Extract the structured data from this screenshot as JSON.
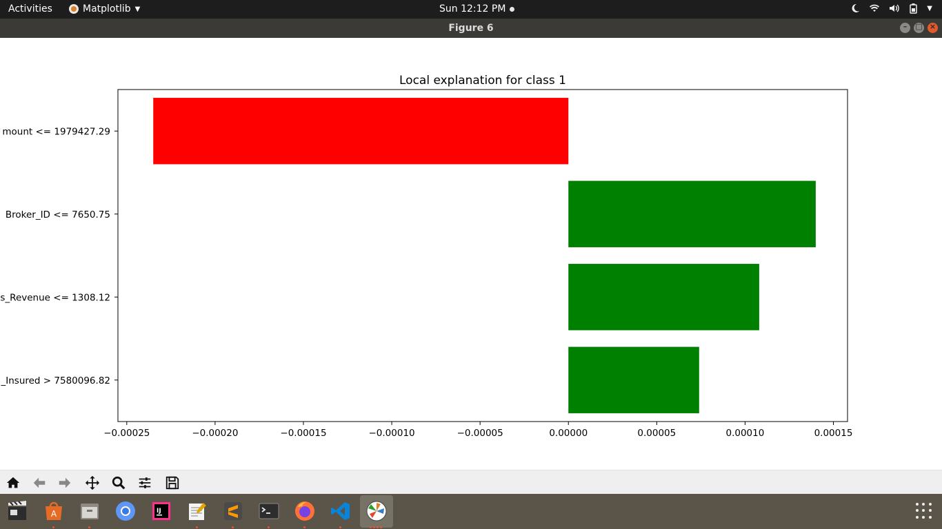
{
  "topbar": {
    "activities": "Activities",
    "app_menu": "Matplotlib",
    "clock": "Sun 12:12 PM"
  },
  "window": {
    "title": "Figure 6"
  },
  "icons": {
    "tray": [
      "night-mode-icon",
      "wifi-icon",
      "volume-icon",
      "battery-icon"
    ],
    "toolbar": [
      "home-icon",
      "back-icon",
      "forward-icon",
      "pan-icon",
      "zoom-icon",
      "configure-subplots-icon",
      "save-icon"
    ],
    "dock": [
      "video-player-icon",
      "software-center-icon",
      "file-manager-icon",
      "chromium-icon",
      "intellij-icon",
      "text-editor-icon",
      "sublime-text-icon",
      "terminal-icon",
      "firefox-icon",
      "vscode-icon",
      "matplotlib-icon"
    ]
  },
  "chart_data": {
    "type": "bar",
    "orientation": "horizontal",
    "title": "Local explanation for class 1",
    "categories": [
      "mount <= 1979427.29",
      " Broker_ID <= 7650.75",
      "s_Revenue <= 1308.12",
      "_Insured > 7580096.82"
    ],
    "values": [
      -0.000235,
      0.00014,
      0.000108,
      7.4e-05
    ],
    "colors": {
      "negative": "#ff0000",
      "positive": "#008000"
    },
    "xlim": [
      -0.000255,
      0.000158
    ],
    "xticks": [
      -0.00025,
      -0.0002,
      -0.00015,
      -0.0001,
      -5e-05,
      0,
      5e-05,
      0.0001,
      0.00015
    ],
    "xtick_labels": [
      "−0.00025",
      "−0.00020",
      "−0.00015",
      "−0.00010",
      "−0.00005",
      "0.00000",
      "0.00005",
      "0.00010",
      "0.00015"
    ],
    "grid": false,
    "legend": "none"
  }
}
